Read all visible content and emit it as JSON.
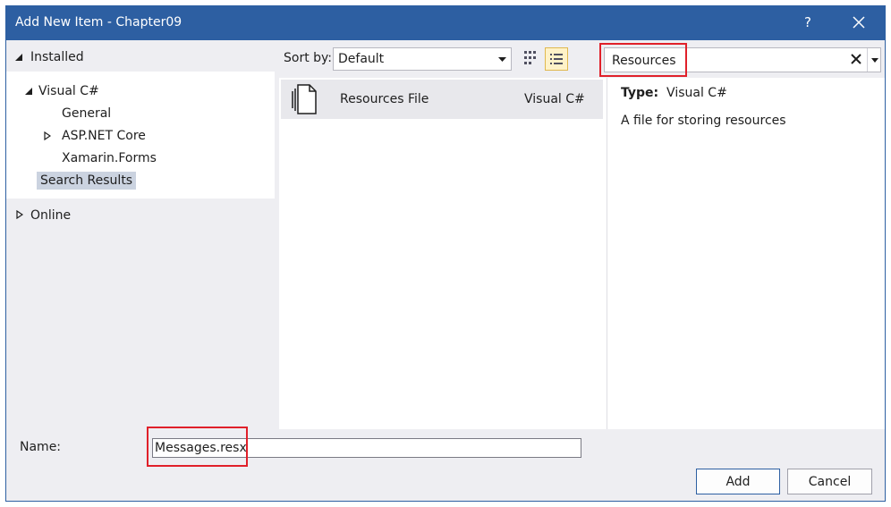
{
  "window": {
    "title": "Add New Item - Chapter09",
    "help_label": "?"
  },
  "sidebar": {
    "installed_label": "Installed",
    "items": [
      {
        "label": "Visual C#"
      },
      {
        "label": "General"
      },
      {
        "label": "ASP.NET Core"
      },
      {
        "label": "Xamarin.Forms"
      },
      {
        "label": "Search Results",
        "selected": true
      }
    ],
    "online_label": "Online"
  },
  "toolbar": {
    "sort_label": "Sort by:",
    "sort_value": "Default",
    "search_value": "Resources"
  },
  "results": [
    {
      "name": "Resources File",
      "language": "Visual C#"
    }
  ],
  "details": {
    "type_key": "Type:",
    "type_value": "Visual C#",
    "description": "A file for storing resources"
  },
  "footer": {
    "name_label": "Name:",
    "name_value": "Messages.resx",
    "add_label": "Add",
    "cancel_label": "Cancel"
  },
  "colors": {
    "title_bar": "#2d5fa2",
    "highlight": "#e0202a",
    "selected": "#cbd3e0"
  }
}
